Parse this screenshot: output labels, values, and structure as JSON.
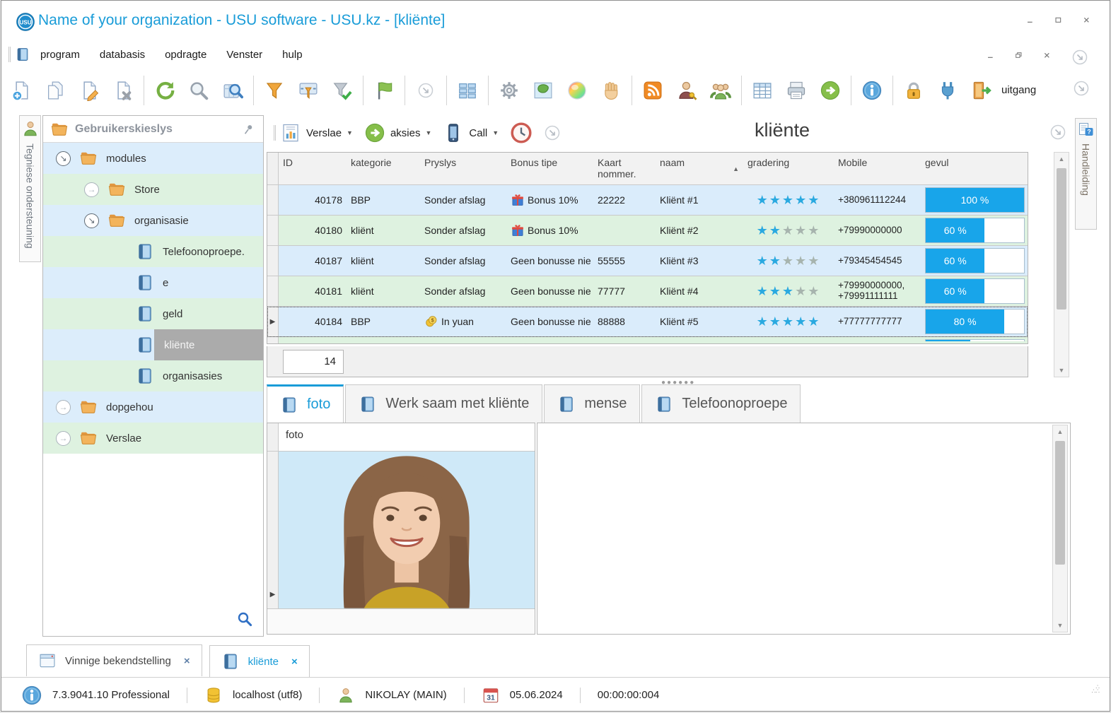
{
  "window": {
    "title": "Name of your organization - USU software - USU.kz - [kliënte]",
    "logo": "usu-logo"
  },
  "menu": {
    "items": [
      "program",
      "databasis",
      "opdragte",
      "Venster",
      "hulp"
    ]
  },
  "toolbar": {
    "groups": [
      [
        "add-record",
        "copy-record",
        "edit-record",
        "delete-record"
      ],
      [
        "refresh",
        "search",
        "search-grid"
      ],
      [
        "filter",
        "filter-range",
        "filter-apply"
      ],
      [
        "flag"
      ],
      [
        "more"
      ],
      [
        "grid-views"
      ],
      [
        "settings",
        "map",
        "color-wheel",
        "hand"
      ],
      [
        "rss",
        "user-key",
        "user-group"
      ],
      [
        "table",
        "print",
        "go-next"
      ],
      [
        "info"
      ],
      [
        "lock",
        "plug",
        "exit"
      ]
    ],
    "uitgang_label": "uitgang"
  },
  "left_tab": {
    "icon": "user",
    "label": "Tegniese ondersteuning"
  },
  "right_tab": {
    "icon": "help-doc",
    "label": "Handleiding"
  },
  "tree": {
    "header": "Gebruikerskieslys",
    "items": [
      {
        "label": "modules",
        "type": "folder",
        "level": 0,
        "expander": "open"
      },
      {
        "label": "Store",
        "type": "folder",
        "level": 1,
        "expander": "closed"
      },
      {
        "label": "organisasie",
        "type": "folder",
        "level": 1,
        "expander": "open"
      },
      {
        "label": "Telefoonoproepe.",
        "type": "book",
        "level": 2
      },
      {
        "label": "e",
        "type": "book",
        "level": 2
      },
      {
        "label": "geld",
        "type": "book",
        "level": 2
      },
      {
        "label": "kliënte",
        "type": "book",
        "level": 2,
        "selected": true
      },
      {
        "label": "organisasies",
        "type": "book",
        "level": 2
      },
      {
        "label": "dopgehou",
        "type": "folder",
        "level": 0,
        "expander": "closed"
      },
      {
        "label": "Verslae",
        "type": "folder",
        "level": 0,
        "expander": "closed"
      }
    ]
  },
  "subtoolbar": {
    "buttons": [
      {
        "icon": "report",
        "label": "Verslae",
        "dropdown": true
      },
      {
        "icon": "go-next",
        "label": "aksies",
        "dropdown": true
      },
      {
        "icon": "phone",
        "label": "Call",
        "dropdown": true
      },
      {
        "icon": "clock",
        "label": "",
        "dropdown": false
      },
      {
        "icon": "more",
        "label": "",
        "dropdown": false
      }
    ],
    "title": "kliënte"
  },
  "table": {
    "columns": [
      {
        "label": "ID"
      },
      {
        "label": "kategorie"
      },
      {
        "label": "Pryslys"
      },
      {
        "label": "Bonus tipe"
      },
      {
        "label": "Kaart nommer."
      },
      {
        "label": "naam",
        "sorted": "asc"
      },
      {
        "label": "gradering"
      },
      {
        "label": "Mobile"
      },
      {
        "label": "gevul"
      }
    ],
    "rows": [
      {
        "id": "40178",
        "kategorie": "BBP",
        "pryslys": "Sonder afslag",
        "pryslys_icon": null,
        "bonus": "Bonus 10%",
        "bonus_icon": "gift",
        "kaart": "22222",
        "naam": "Kliënt #1",
        "stars": 5,
        "mobile": "+380961112244",
        "gevul_label": "100 %",
        "gevul_pct": 100,
        "selected": false
      },
      {
        "id": "40180",
        "kategorie": "kliënt",
        "pryslys": "Sonder afslag",
        "pryslys_icon": null,
        "bonus": "Bonus 10%",
        "bonus_icon": "gift",
        "kaart": "",
        "naam": "Kliënt #2",
        "stars": 2,
        "mobile": "+79990000000",
        "gevul_label": "60 %",
        "gevul_pct": 60,
        "selected": false
      },
      {
        "id": "40187",
        "kategorie": "kliënt",
        "pryslys": "Sonder afslag",
        "pryslys_icon": null,
        "bonus": "Geen bonusse nie",
        "bonus_icon": null,
        "kaart": "55555",
        "naam": "Kliënt #3",
        "stars": 2,
        "mobile": "+79345454545",
        "gevul_label": "60 %",
        "gevul_pct": 60,
        "selected": false
      },
      {
        "id": "40181",
        "kategorie": "kliënt",
        "pryslys": "Sonder afslag",
        "pryslys_icon": null,
        "bonus": "Geen bonusse nie",
        "bonus_icon": null,
        "kaart": "77777",
        "naam": "Kliënt #4",
        "stars": 3,
        "mobile": "+79990000000, +79991111111",
        "gevul_label": "60 %",
        "gevul_pct": 60,
        "selected": false
      },
      {
        "id": "40184",
        "kategorie": "BBP",
        "pryslys": "In yuan",
        "pryslys_icon": "coins",
        "bonus": "Geen bonusse nie",
        "bonus_icon": null,
        "kaart": "88888",
        "naam": "Kliënt #5",
        "stars": 5,
        "mobile": "+77777777777",
        "gevul_label": "80 %",
        "gevul_pct": 80,
        "selected": true
      }
    ],
    "partial_row": {
      "gevul_pct": 45
    },
    "footer_count": "14"
  },
  "detail_tabs": [
    {
      "icon": "book",
      "label": "foto",
      "active": true
    },
    {
      "icon": "book",
      "label": "Werk saam met kliënte",
      "active": false
    },
    {
      "icon": "book",
      "label": "mense",
      "active": false
    },
    {
      "icon": "book",
      "label": "Telefoonoproepe",
      "active": false
    }
  ],
  "foto_panel": {
    "header": "foto"
  },
  "bottom_tabs": [
    {
      "icon": "window",
      "label": "Vinnige bekendstelling",
      "close": "×",
      "active": false
    },
    {
      "icon": "book",
      "label": "kliënte",
      "close": "×",
      "active": true
    }
  ],
  "statusbar": {
    "items": [
      {
        "icon": "info",
        "text": "7.3.9041.10 Professional"
      },
      {
        "icon": "database",
        "text": "localhost (utf8)"
      },
      {
        "icon": "user",
        "text": "NIKOLAY (MAIN)"
      },
      {
        "icon": "calendar",
        "text": "05.06.2024"
      },
      {
        "icon": null,
        "text": "00:00:00:004"
      }
    ],
    "calendar_day": "31"
  },
  "colors": {
    "accent_blue": "#199cd8",
    "progress_blue": "#18a5ea",
    "star_blue": "#2aa9e0",
    "row_blue": "#daecfb",
    "row_green": "#def2e0",
    "selected_gray": "#ababab"
  }
}
